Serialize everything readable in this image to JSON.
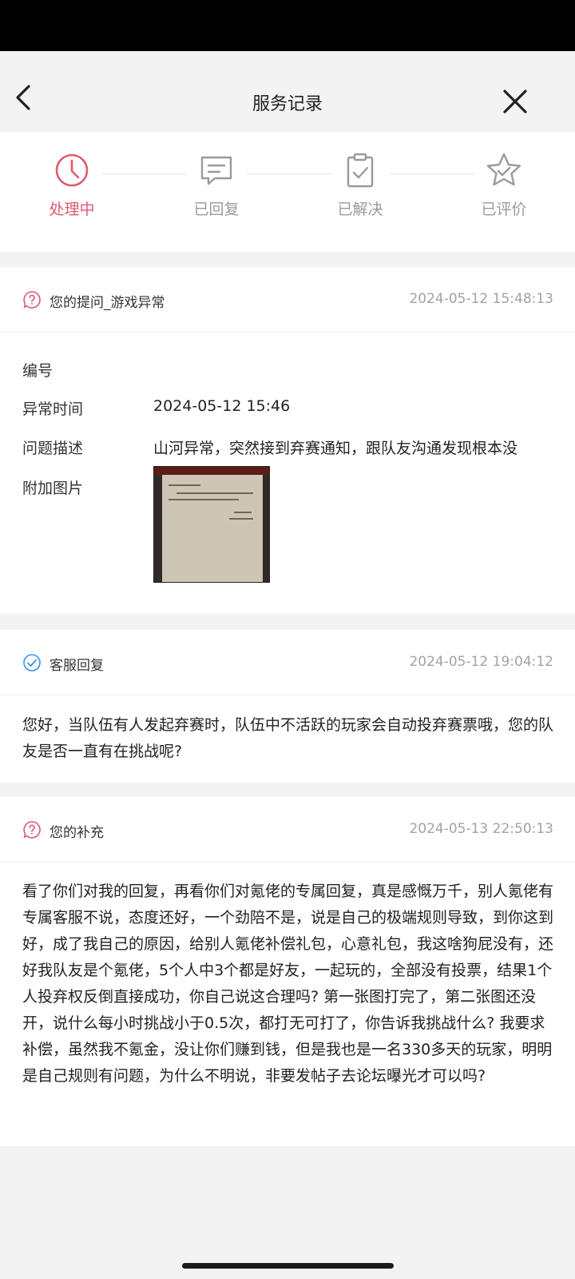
{
  "header": {
    "title": "服务记录"
  },
  "steps": [
    {
      "label": "处理中"
    },
    {
      "label": "已回复"
    },
    {
      "label": "已解决"
    },
    {
      "label": "已评价"
    }
  ],
  "question": {
    "title": "您的提问_游戏异常",
    "time": "2024-05-12 15:48:13",
    "fields": {
      "id_label": "编号",
      "time_label": "异常时间",
      "time_value": "2024-05-12 15:46",
      "desc_label": "问题描述",
      "desc_value": "山河异常，突然接到弃赛通知，跟队友沟通发现根本没",
      "image_label": "附加图片"
    }
  },
  "reply": {
    "title": "客服回复",
    "time": "2024-05-12 19:04:12",
    "text": "您好，当队伍有人发起弃赛时，队伍中不活跃的玩家会自动投弃赛票哦，您的队友是否一直有在挑战呢?"
  },
  "supplement": {
    "title": "您的补充",
    "time": "2024-05-13 22:50:13",
    "text": "看了你们对我的回复，再看你们对氪佬的专属回复，真是感慨万千，别人氪佬有专属客服不说，态度还好，一个劲陪不是，说是自己的极端规则导致，到你这到好，成了我自己的原因，给别人氪佬补偿礼包，心意礼包，我这啥狗屁没有，还好我队友是个氪佬，5个人中3个都是好友，一起玩的，全部没有投票，结果1个人投弃权反倒直接成功，你自己说这合理吗? 第一张图打完了，第二张图还没开，说什么每小时挑战小于0.5次，都打无可打了，你告诉我挑战什么? 我要求补偿，虽然我不氪金，没让你们赚到钱，但是我也是一名330多天的玩家，明明是自己规则有问题，为什么不明说，非要发帖子去论坛曝光才可以吗?"
  },
  "colors": {
    "accent": "#e05a72",
    "inactive": "#9a9a9a",
    "reply_icon": "#3a8ee6"
  }
}
